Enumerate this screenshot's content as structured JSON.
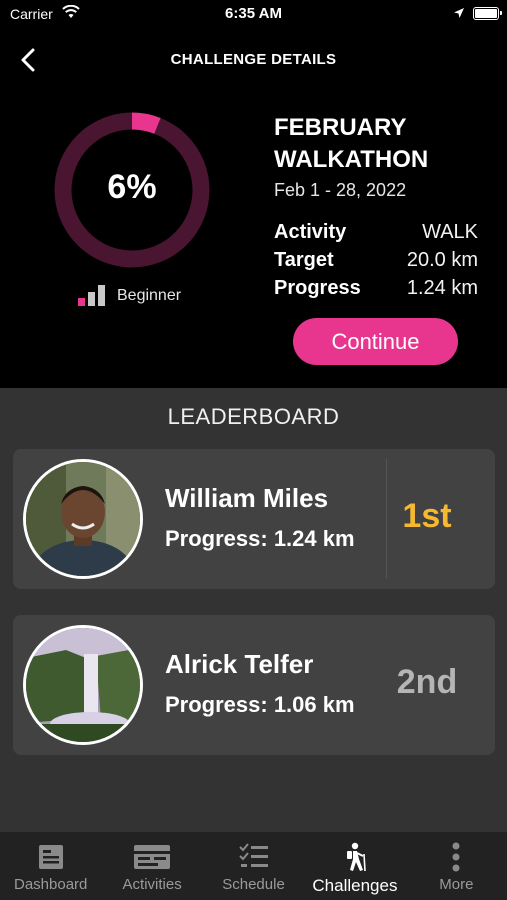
{
  "status_bar": {
    "carrier": "Carrier",
    "time": "6:35 AM",
    "icons": [
      "wifi-icon",
      "location-arrow-icon",
      "battery-icon"
    ]
  },
  "header": {
    "title": "CHALLENGE DETAILS",
    "back_icon": "chevron-left-icon"
  },
  "challenge": {
    "progress_label": "6%",
    "progress_fraction": 0.06,
    "level": "Beginner",
    "level_bars_filled": 1,
    "name_line1": "FEBRUARY",
    "name_line2": "WALKATHON",
    "dates": "Feb 1 - 28, 2022",
    "stats": [
      {
        "key": "Activity",
        "value": "WALK"
      },
      {
        "key": "Target",
        "value": "20.0 km"
      },
      {
        "key": "Progress",
        "value": "1.24 km"
      }
    ],
    "continue_label": "Continue"
  },
  "leaderboard": {
    "title": "LEADERBOARD",
    "entries": [
      {
        "name": "William Miles",
        "progress": "Progress: 1.24 km",
        "rank": "1st",
        "rank_color": "#f5b82e"
      },
      {
        "name": "Alrick Telfer",
        "progress": "Progress: 1.06 km",
        "rank": "2nd",
        "rank_color": "#b5b5b5"
      }
    ]
  },
  "tabs": [
    {
      "label": "Dashboard",
      "icon": "dashboard-icon",
      "active": false
    },
    {
      "label": "Activities",
      "icon": "activities-icon",
      "active": false
    },
    {
      "label": "Schedule",
      "icon": "schedule-checklist-icon",
      "active": false
    },
    {
      "label": "Challenges",
      "icon": "hiker-icon",
      "active": true
    },
    {
      "label": "More",
      "icon": "more-dots-icon",
      "active": false
    }
  ],
  "colors": {
    "accent": "#e8368f",
    "ring_track": "#4a1530",
    "gold": "#f5b82e",
    "silver": "#b5b5b5",
    "level_inactive": "#c8c8c8"
  }
}
